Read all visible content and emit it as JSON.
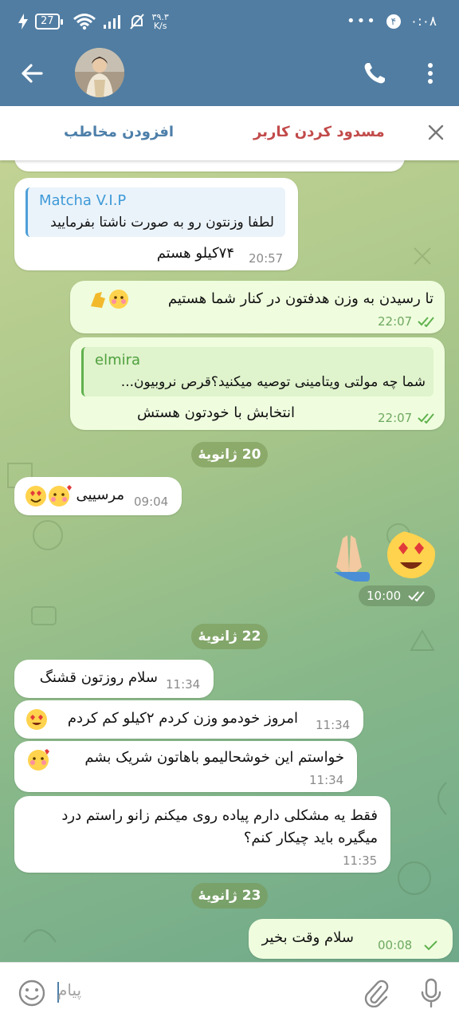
{
  "status_bar": {
    "battery": "27",
    "net_speed": "۳۹.۳\nK/s",
    "more": "•••",
    "notif_count": "۴",
    "time": "۰:۰۸"
  },
  "header": {
    "back_icon": "arrow-left-icon",
    "call_icon": "phone-icon",
    "menu_icon": "more-vertical-icon"
  },
  "action_bar": {
    "add_contact": "افزودن مخاطب",
    "block_user": "مسدود کردن کاربر",
    "close_icon": "close-icon"
  },
  "messages": [
    {
      "dir": "in",
      "quote_name": "Matcha V.I.P",
      "quote_text": "لطفا وزنتون رو به صورت ناشتا بفرمایید",
      "text": "۷۴کیلو هستم",
      "time": "20:57"
    },
    {
      "dir": "out",
      "text": "تا رسیدن به وزن هدفتون در کنار شما هستیم",
      "time": "22:07"
    },
    {
      "dir": "out",
      "quote_name": "elmira",
      "quote_text": "شما چه مولتی ویتامینی توصیه میکنید؟قرص نروبیون...",
      "text": "انتخابش با خودتون هستش",
      "time": "22:07"
    },
    {
      "dir": "in",
      "text": "مرسییی",
      "time": "09:04"
    },
    {
      "dir": "out",
      "sticker": "heart-eyes-praying-hands",
      "time": "10:00"
    },
    {
      "dir": "in",
      "text": "سلام روزتون قشنگ",
      "time": "11:34"
    },
    {
      "dir": "in",
      "text": "امروز خودمو وزن کردم ۲کیلو کم کردم",
      "time": "11:34"
    },
    {
      "dir": "in",
      "text": "خواستم این خوشحالیمو باهاتون شریک بشم",
      "time": "11:34"
    },
    {
      "dir": "in",
      "text_line1": "فقط یه مشکلی دارم پیاده روی میکنم زانو راستم درد",
      "text_line2": "میگیره باید چیکار کنم؟",
      "time": "11:35"
    },
    {
      "dir": "out",
      "text": "سلام وقت بخیر",
      "time": "00:08"
    }
  ],
  "dates": [
    "20 ژانویهٔ",
    "22 ژانویهٔ",
    "23 ژانویهٔ"
  ],
  "input": {
    "placeholder": "پیام",
    "emoji_icon": "smile-icon",
    "attach_icon": "paperclip-icon",
    "mic_icon": "microphone-icon"
  },
  "colors": {
    "header": "#517da2",
    "incoming": "#ffffff",
    "outgoing": "#effdde",
    "link_blue": "#4d7fa9",
    "block_red": "#c24a4a"
  }
}
